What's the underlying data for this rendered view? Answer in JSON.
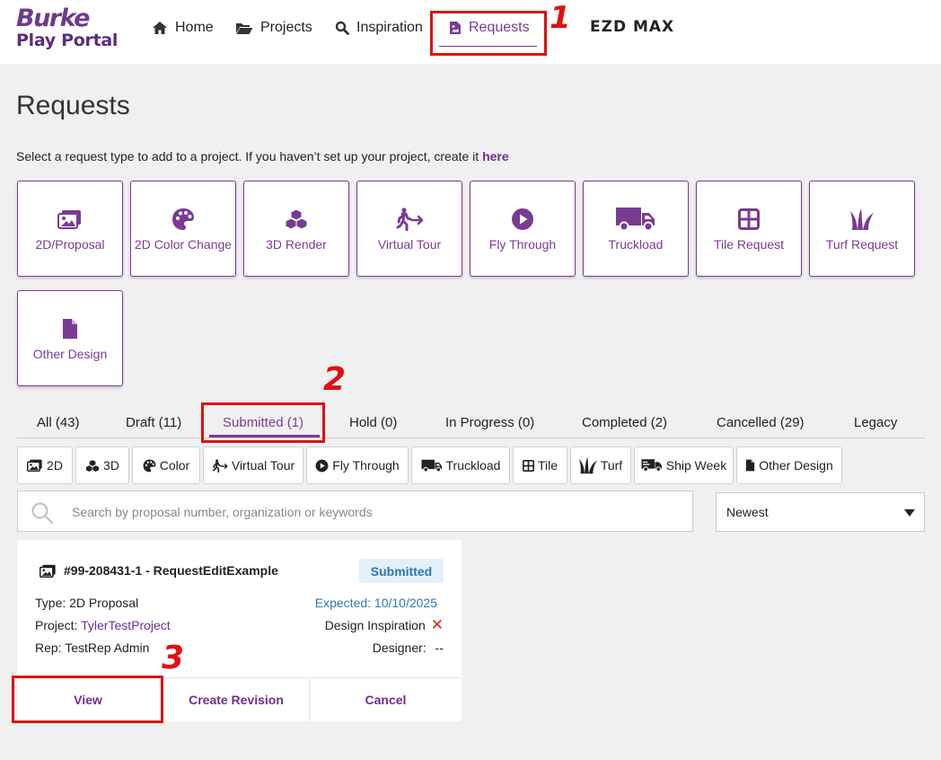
{
  "header": {
    "logo_line1": "Burke",
    "logo_line2": "Play Portal",
    "nav": [
      {
        "label": "Home",
        "icon": "home-icon"
      },
      {
        "label": "Projects",
        "icon": "folder-open-icon"
      },
      {
        "label": "Inspiration",
        "icon": "search-icon"
      },
      {
        "label": "Requests",
        "icon": "file-image-icon",
        "active": true
      }
    ],
    "ezd_label": "EZD MAX"
  },
  "annotations": [
    "1",
    "2",
    "3"
  ],
  "page": {
    "title": "Requests",
    "intro_text": "Select a request type to add to a project. If you haven’t set up your project, create it ",
    "intro_link": "here"
  },
  "request_types": [
    {
      "label": "2D/Proposal",
      "icon": "images-icon"
    },
    {
      "label": "2D Color Change",
      "icon": "palette-icon"
    },
    {
      "label": "3D Render",
      "icon": "cubes-icon"
    },
    {
      "label": "Virtual Tour",
      "icon": "walking-icon"
    },
    {
      "label": "Fly Through",
      "icon": "play-circle-icon"
    },
    {
      "label": "Truckload",
      "icon": "truck-icon"
    },
    {
      "label": "Tile Request",
      "icon": "tile-icon"
    },
    {
      "label": "Turf Request",
      "icon": "turf-icon"
    },
    {
      "label": "Other Design",
      "icon": "file-icon"
    }
  ],
  "status_tabs": [
    {
      "label": "All (43)"
    },
    {
      "label": "Draft (11)"
    },
    {
      "label": "Submitted (1)",
      "active": true
    },
    {
      "label": "Hold (0)"
    },
    {
      "label": "In Progress (0)"
    },
    {
      "label": "Completed (2)"
    },
    {
      "label": "Cancelled (29)"
    },
    {
      "label": "Legacy"
    }
  ],
  "filter_chips": [
    {
      "label": "2D",
      "icon": "images-icon"
    },
    {
      "label": "3D",
      "icon": "cubes-icon"
    },
    {
      "label": "Color",
      "icon": "palette-icon"
    },
    {
      "label": "Virtual Tour",
      "icon": "walking-icon"
    },
    {
      "label": "Fly Through",
      "icon": "play-circle-icon"
    },
    {
      "label": "Truckload",
      "icon": "truck-icon"
    },
    {
      "label": "Tile",
      "icon": "tile-icon"
    },
    {
      "label": "Turf",
      "icon": "turf-icon"
    },
    {
      "label": "Ship Week",
      "icon": "shipping-icon"
    },
    {
      "label": "Other Design",
      "icon": "file-icon"
    }
  ],
  "search": {
    "placeholder": "Search by proposal number, organization or keywords",
    "value": ""
  },
  "sort": {
    "selected": "Newest"
  },
  "request_card": {
    "title": "#99-208431-1 - RequestEditExample",
    "status": "Submitted",
    "type_label": "Type:",
    "type_value": "2D Proposal",
    "project_label": "Project:",
    "project_value": "TylerTestProject",
    "rep_label": "Rep:",
    "rep_value": "TestRep Admin",
    "expected": "Expected: 10/10/2025",
    "design_inspiration_label": "Design Inspiration",
    "design_inspiration_value": "✕",
    "designer_label": "Designer:",
    "designer_value": "--",
    "actions": {
      "view": "View",
      "revision": "Create Revision",
      "cancel": "Cancel"
    }
  },
  "colors": {
    "brand": "#7a3b93",
    "status_blue": "#2f77b8",
    "annotation_red": "#e01010"
  }
}
